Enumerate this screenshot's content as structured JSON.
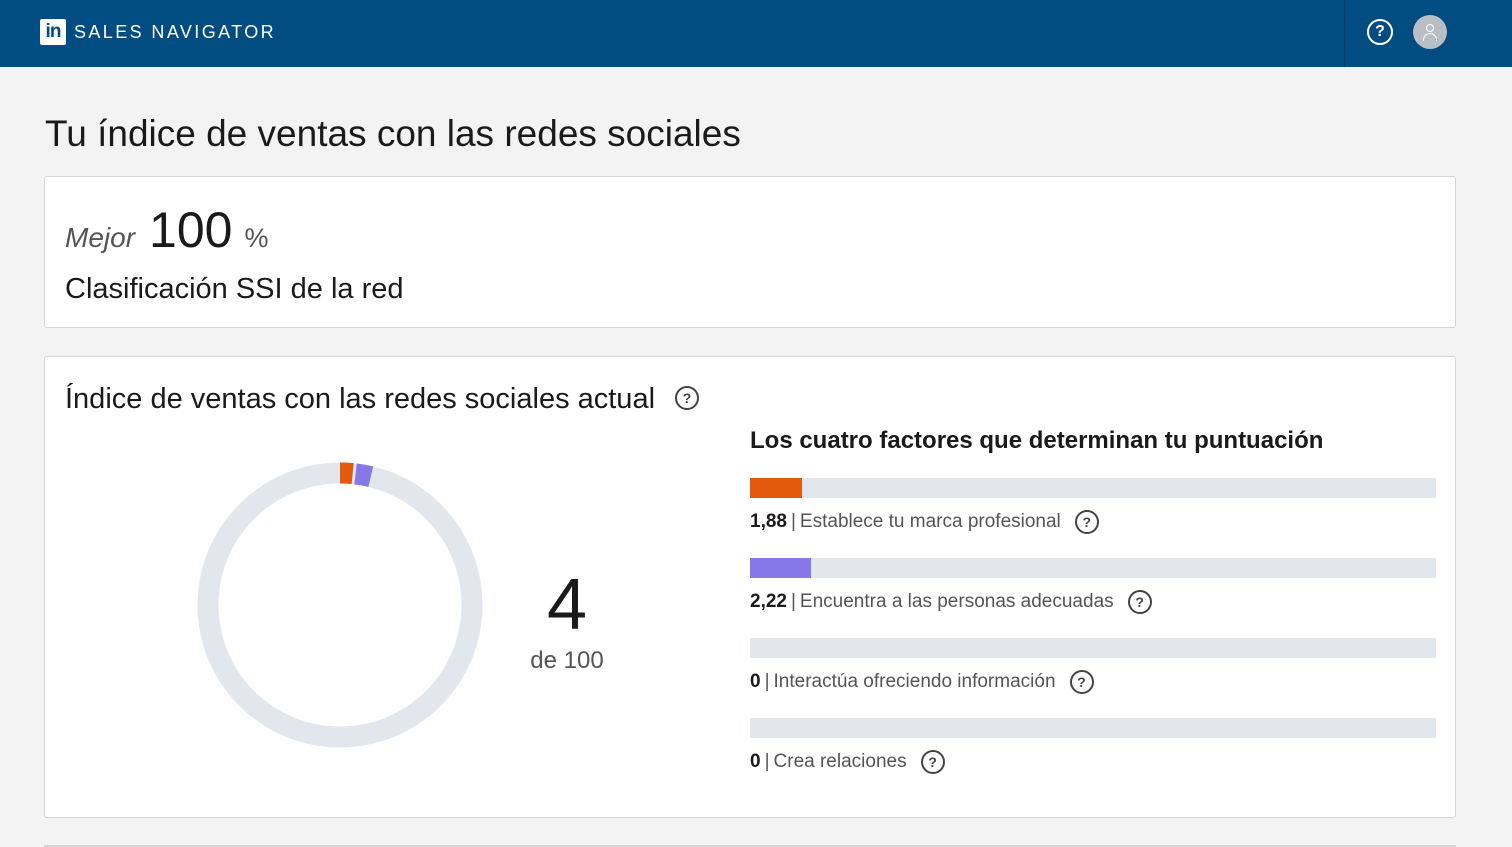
{
  "header": {
    "logo": "in",
    "brand": "SALES NAVIGATOR",
    "help_label": "?"
  },
  "page": {
    "title": "Tu índice de ventas con las redes sociales"
  },
  "rank": {
    "label": "Mejor",
    "value": "100",
    "unit": "%",
    "subtitle": "Clasificación SSI de la red"
  },
  "ssi": {
    "title": "Índice de ventas con las redes sociales actual",
    "score": "4",
    "score_sub": "de 100",
    "max": 100,
    "ring_color": "#e2e7ee",
    "factors_title": "Los cuatro factores que determinan tu puntuación",
    "factors": [
      {
        "value": "1,88",
        "sep": "|",
        "label": "Establece tu marca profesional",
        "score": 1.88,
        "max": 25,
        "color": "#e35a0e"
      },
      {
        "value": "2,22",
        "sep": "|",
        "label": "Encuentra a las personas adecuadas",
        "score": 2.22,
        "max": 25,
        "color": "#8878e6"
      },
      {
        "value": "0",
        "sep": "|",
        "label": "Interactúa ofreciendo información",
        "score": 0,
        "max": 25,
        "color": "#3ab5c6"
      },
      {
        "value": "0",
        "sep": "|",
        "label": "Crea relaciones",
        "score": 0,
        "max": 25,
        "color": "#2a7ad6"
      }
    ]
  }
}
